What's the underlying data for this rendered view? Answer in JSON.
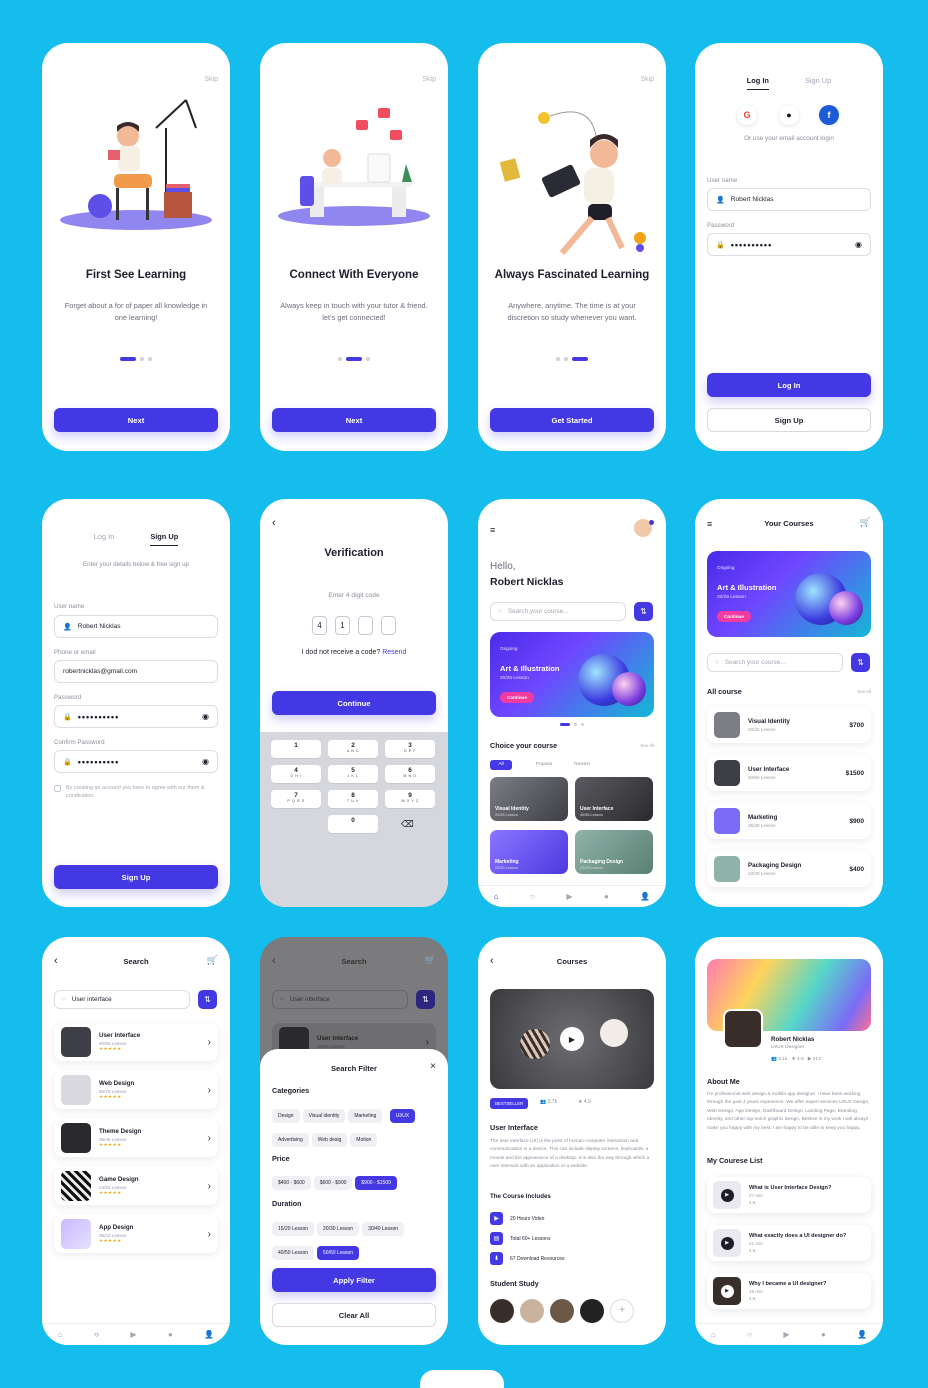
{
  "onboarding": [
    {
      "skip": "Skip",
      "title": "First See Learning",
      "desc": "Forget about a for of paper all knowledge in one learning!",
      "button": "Next"
    },
    {
      "skip": "Skip",
      "title": "Connect With Everyone",
      "desc": "Always keep in touch with your tutor & friend. let's get connected!",
      "button": "Next"
    },
    {
      "skip": "Skip",
      "title": "Always Fascinated Learning",
      "desc": "Anywhere, anytime. The time is at your discretion so study whenever you want.",
      "button": "Get Started"
    }
  ],
  "login": {
    "tab_login": "Log In",
    "tab_signup": "Sign Up",
    "social_hint": "Or use your email account login",
    "username_label": "User name",
    "username_value": "Robert Nicklas",
    "password_label": "Password",
    "password_value": "••••••••••",
    "login_button": "Log In",
    "signup_button": "Sign Up"
  },
  "signup": {
    "tab_login": "Log In",
    "tab_signup": "Sign Up",
    "hint": "Enter your details below & free sign up",
    "username_label": "User name",
    "username_value": "Robert Nicklas",
    "email_label": "Phone or email",
    "email_value": "robertnicklas@gmail.com",
    "password_label": "Password",
    "password_value": "••••••••••",
    "confirm_label": "Confirm Password",
    "confirm_value": "••••••••••",
    "terms": "By creating an account you have to agree with our them & condication.",
    "button": "Sign Up"
  },
  "verification": {
    "title": "Verification",
    "hint": "Enter 4 digit code",
    "code": [
      "4",
      "1",
      "",
      ""
    ],
    "no_code": "I dod not receive a code?",
    "resend": "Resend",
    "button": "Continue",
    "keys": [
      {
        "n": "1",
        "l": ""
      },
      {
        "n": "2",
        "l": "A B C"
      },
      {
        "n": "3",
        "l": "D E F"
      },
      {
        "n": "4",
        "l": "G H I"
      },
      {
        "n": "5",
        "l": "J K L"
      },
      {
        "n": "6",
        "l": "M N O"
      },
      {
        "n": "7",
        "l": "P Q R S"
      },
      {
        "n": "8",
        "l": "T U V"
      },
      {
        "n": "9",
        "l": "W X Y Z"
      },
      {
        "n": "0",
        "l": ""
      }
    ],
    "backspace": "⌫"
  },
  "home": {
    "hello": "Hello,",
    "name": "Robert Nicklas",
    "search_placeholder": "Search your course...",
    "banner_tag": "Ongoing",
    "banner_title": "Art & Illustration",
    "banner_sub": "20/25 Lesson",
    "banner_btn": "Continue",
    "section": "Choice your course",
    "see_all": "See All",
    "filters": [
      "All",
      "Popular",
      "Newest"
    ],
    "courses": [
      {
        "title": "Visual Identity",
        "sub": "20/25 Lesson"
      },
      {
        "title": "User Interface",
        "sub": "40/56 Lesson"
      },
      {
        "title": "Marketing",
        "sub": "25/39 Lesson"
      },
      {
        "title": "Packaging Design",
        "sub": "23/29 Lesson"
      }
    ]
  },
  "your_courses": {
    "title": "Your Courses",
    "banner_tag": "Ongoing",
    "banner_title": "Art & Illustration",
    "banner_sub": "20/25 Lesson",
    "banner_btn": "Continue",
    "search_placeholder": "Search your course...",
    "section": "All course",
    "see_all": "See All",
    "items": [
      {
        "title": "Visual Identity",
        "sub": "20/25 Lesson",
        "price": "$700"
      },
      {
        "title": "User Interface",
        "sub": "40/56 Lesson",
        "price": "$1500"
      },
      {
        "title": "Marketing",
        "sub": "25/39 Lesson",
        "price": "$900"
      },
      {
        "title": "Packaging Design",
        "sub": "23/29 Lesson",
        "price": "$400"
      }
    ]
  },
  "search": {
    "title": "Search",
    "query": "User interface",
    "items": [
      {
        "title": "User Interface",
        "sub": "40/56 Lesson",
        "stars": "★★★★★"
      },
      {
        "title": "Web Design",
        "sub": "50/78 Lesson",
        "stars": "★★★★★"
      },
      {
        "title": "Theme Design",
        "sub": "36/48 Lesson",
        "stars": "★★★★★"
      },
      {
        "title": "Game Design",
        "sub": "24/32 Lesson",
        "stars": "★★★★★"
      },
      {
        "title": "App Design",
        "sub": "36/42 Lesson",
        "stars": "★★★★★"
      }
    ]
  },
  "filter": {
    "bg_title": "Search",
    "bg_query": "User interface",
    "bg_item": "User Interface",
    "bg_item_sub": "40/56 Lesson",
    "title": "Search Filter",
    "close": "×",
    "categories_label": "Categories",
    "categories": [
      {
        "label": "Design",
        "on": false
      },
      {
        "label": "Visual identity",
        "on": false
      },
      {
        "label": "Marketing",
        "on": false
      },
      {
        "label": "UI/UX",
        "on": true
      },
      {
        "label": "Advertising",
        "on": false
      },
      {
        "label": "Web desig",
        "on": false
      },
      {
        "label": "Motion",
        "on": false
      }
    ],
    "price_label": "Price",
    "prices": [
      {
        "label": "$400 - $600",
        "on": false
      },
      {
        "label": "$600 - $900",
        "on": false
      },
      {
        "label": "$900 - $1500",
        "on": true
      }
    ],
    "duration_label": "Duration",
    "durations": [
      {
        "label": "15/20 Lesson",
        "on": false
      },
      {
        "label": "20/30 Lesson",
        "on": false
      },
      {
        "label": "30/40 Lesson",
        "on": false
      },
      {
        "label": "40/50 Lesson",
        "on": false
      },
      {
        "label": "50/60 Lesson",
        "on": true
      }
    ],
    "apply": "Apply Filter",
    "clear": "Clear All"
  },
  "course_detail": {
    "title": "Courses",
    "badge": "BESTSELLER",
    "students": "3.7k",
    "rating": "4.9",
    "heading": "User Interface",
    "desc": "The user interface (UI) is the point of human-computer interaction and communication in a device. This can include display screens, keyboards, a mouse and the appearance of a desktop. It is also the way through which a user interacts with an application or a website.",
    "includes_title": "The Course Includes",
    "includes": [
      "20 Hours Video",
      "Total 60+ Lessons",
      "67 Download Resources"
    ],
    "students_title": "Student Study",
    "add": "+"
  },
  "profile": {
    "name": "Robert Nicklas",
    "role": "UI/UX Designer",
    "stats": [
      "3.1k",
      "4.9",
      "213"
    ],
    "about_title": "About Me",
    "about": "I'm professional web design & mobile app designer. I have been working through the past 4 years experience. We offer expert services UI/UX Design, Web Design, App Design, Dashboard Design, Landing Page, Branding, Identity, and other top-notch graphic design. Believe in my work I will always make you happy with my best. I am happy to be able to keep you happy.",
    "list_title": "My Courese List",
    "videos": [
      {
        "title": "What is User Interface Design?",
        "time": "27 min",
        "rating": "4.9"
      },
      {
        "title": "What exactly does a UI designer do?",
        "time": "21 min",
        "rating": "4.8"
      },
      {
        "title": "Why I became a UI designer?",
        "time": "19 min",
        "rating": "4.9"
      }
    ]
  },
  "colors": {
    "background": "#14bdec",
    "accent": "#4438e4",
    "pink": "#f23aa0"
  }
}
